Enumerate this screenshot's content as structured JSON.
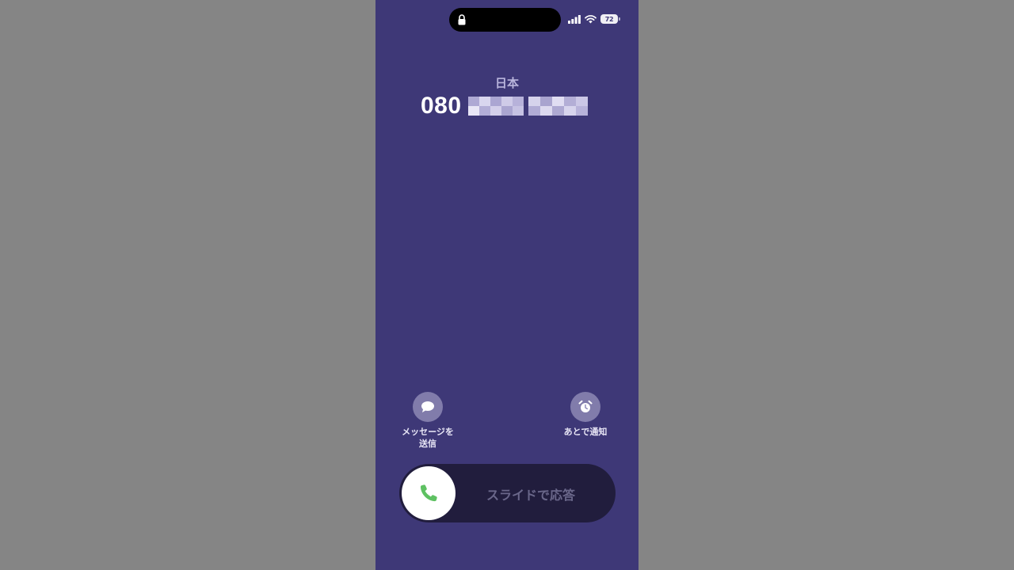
{
  "status_bar": {
    "battery_level": "72",
    "icons": [
      "lock-icon",
      "signal-icon",
      "wifi-icon",
      "battery-icon"
    ]
  },
  "caller": {
    "location": "日本",
    "number_prefix": "080",
    "number_rest_redacted": true
  },
  "actions": {
    "message": {
      "label": "メッセージを送信",
      "icon": "message-bubble-icon"
    },
    "remind": {
      "label": "あとで通知",
      "icon": "alarm-clock-icon"
    }
  },
  "answer_slider": {
    "label": "スライドで応答",
    "icon": "phone-icon",
    "accent": "#5ec162"
  },
  "colors": {
    "background": "#3e3877",
    "outer": "#858585",
    "slider_track": "#211d3d"
  }
}
